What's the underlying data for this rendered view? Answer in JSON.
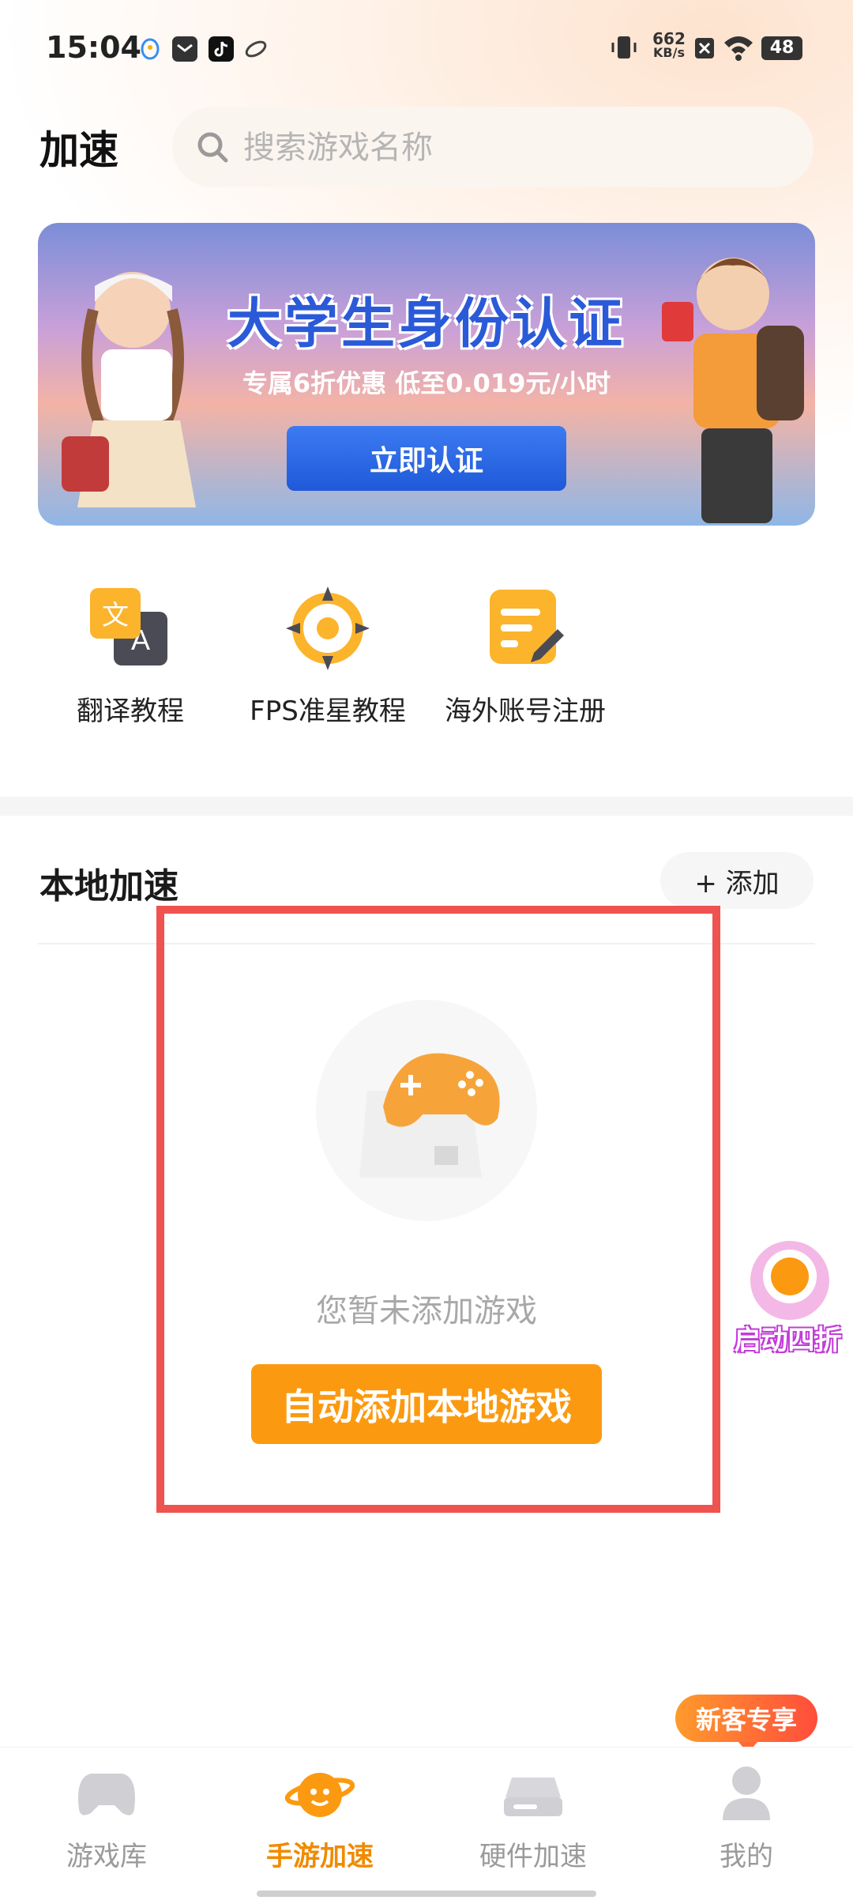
{
  "status_bar": {
    "time": "15:04",
    "net_speed": "662",
    "net_unit": "KB/s",
    "battery": "48"
  },
  "header": {
    "title": "加速",
    "search_placeholder": "搜索游戏名称"
  },
  "banner": {
    "title": "大学生身份认证",
    "subtitle": "专属6折优惠  低至0.019元/小时",
    "cta": "立即认证"
  },
  "tools": [
    {
      "label": "翻译教程",
      "icon": "translate-icon"
    },
    {
      "label": "FPS准星教程",
      "icon": "crosshair-icon"
    },
    {
      "label": "海外账号注册",
      "icon": "note-edit-icon"
    }
  ],
  "local": {
    "title": "本地加速",
    "add_label": "+ 添加",
    "empty_text": "您暂未添加游戏",
    "auto_add_label": "自动添加本地游戏"
  },
  "promo_float": {
    "text": "启动四折"
  },
  "newcomer_badge": "新客专享",
  "tabs": [
    {
      "label": "游戏库",
      "icon": "gamepad-icon",
      "active": false
    },
    {
      "label": "手游加速",
      "icon": "planet-icon",
      "active": true
    },
    {
      "label": "硬件加速",
      "icon": "router-icon",
      "active": false
    },
    {
      "label": "我的",
      "icon": "user-icon",
      "active": false
    }
  ],
  "colors": {
    "accent": "#fb9a10",
    "active_tab": "#f08a00",
    "highlight_frame": "#ee5350",
    "banner_cta": "#2a66e0"
  }
}
